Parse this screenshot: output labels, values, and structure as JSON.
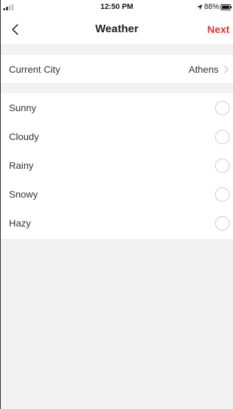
{
  "status_bar": {
    "time": "12:50 PM",
    "battery": "88%",
    "icons": [
      "signal-icon",
      "location-icon",
      "battery-icon"
    ]
  },
  "nav": {
    "back_icon": "chevron-left-icon",
    "title": "Weather",
    "next_label": "Next"
  },
  "city": {
    "label": "Current City",
    "value": "Athens",
    "icon": "chevron-right-icon"
  },
  "options": [
    {
      "label": "Sunny",
      "selected": false
    },
    {
      "label": "Cloudy",
      "selected": false
    },
    {
      "label": "Rainy",
      "selected": false
    },
    {
      "label": "Snowy",
      "selected": false
    },
    {
      "label": "Hazy",
      "selected": false
    }
  ],
  "colors": {
    "accent": "#d9363e",
    "background": "#f2f2f2",
    "surface": "#ffffff",
    "text": "#333333"
  }
}
